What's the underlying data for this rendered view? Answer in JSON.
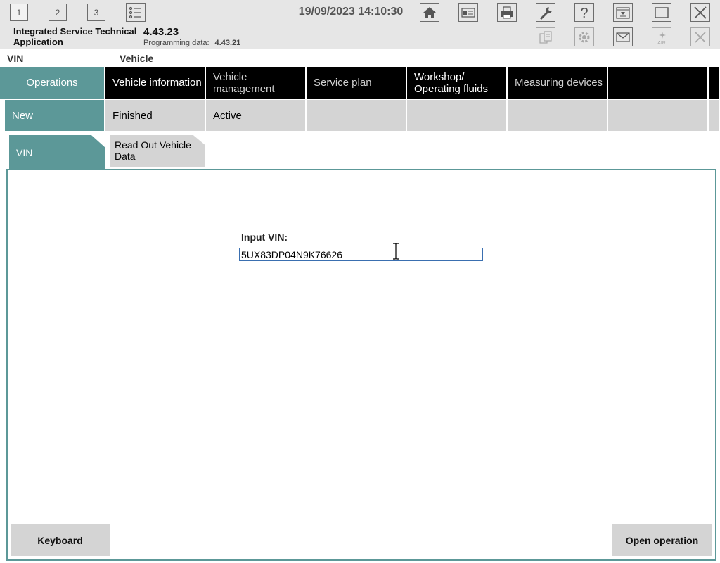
{
  "toolbar": {
    "windows": [
      "1",
      "2",
      "3"
    ],
    "datetime": "19/09/2023 14:10:30"
  },
  "app": {
    "name": "Integrated Service Technical Application",
    "version": "4.43.23",
    "programming_label": "Programming data:",
    "programming_version": "4.43.21"
  },
  "context": {
    "vin_label": "VIN",
    "vehicle_label": "Vehicle"
  },
  "main_tabs": [
    {
      "label": "Operations"
    },
    {
      "label": "Vehicle information"
    },
    {
      "label": "Vehicle management"
    },
    {
      "label": "Service plan"
    },
    {
      "label": "Workshop/ Operating fluids"
    },
    {
      "label": "Measuring devices"
    },
    {
      "label": ""
    }
  ],
  "sub_tabs": [
    {
      "label": "New"
    },
    {
      "label": "Finished"
    },
    {
      "label": "Active"
    }
  ],
  "inner_tabs": {
    "vin": "VIN",
    "read_out": "Read Out Vehicle Data"
  },
  "form": {
    "vin_label": "Input VIN:",
    "vin_value": "5UX83DP04N9K76626"
  },
  "buttons": {
    "keyboard": "Keyboard",
    "open_operation": "Open operation"
  },
  "colors": {
    "accent": "#5c9898",
    "tab_black": "#000000",
    "tab_gray": "#d4d4d4"
  }
}
